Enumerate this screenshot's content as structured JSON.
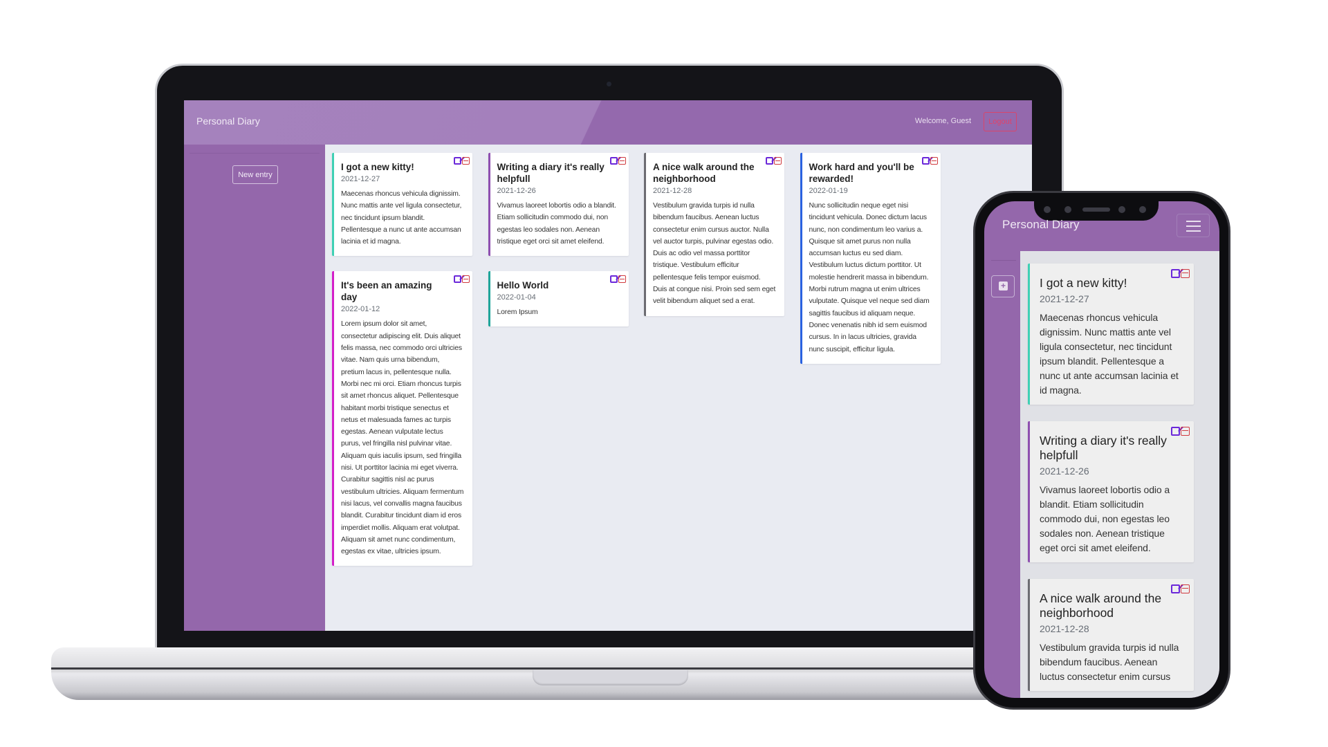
{
  "app": {
    "title": "Personal Diary",
    "welcome": "Welcome, Guest",
    "logout_label": "Logout",
    "new_entry_label": "New entry"
  },
  "colors": {
    "brand": "#9467ab",
    "logout": "#e0436a",
    "edit": "#6b28d9",
    "delete": "#d0393e"
  },
  "entries": [
    {
      "title": "I got a new kitty!",
      "date": "2021-12-27",
      "body": "Maecenas rhoncus vehicula dignissim. Nunc mattis ante vel ligula consectetur, nec tincidunt ipsum blandit. Pellentesque a nunc ut ante accumsan lacinia et id magna.",
      "color": "#3fd0b4"
    },
    {
      "title": "Writing a diary it's really helpfull",
      "date": "2021-12-26",
      "body": "Vivamus laoreet lobortis odio a blandit. Etiam sollicitudin commodo dui, non egestas leo sodales non. Aenean tristique eget orci sit amet eleifend.",
      "color": "#8e4fb0"
    },
    {
      "title": "A nice walk around the neighborhood",
      "date": "2021-12-28",
      "body": "Vestibulum gravida turpis id nulla bibendum faucibus. Aenean luctus consectetur enim cursus auctor. Nulla vel auctor turpis, pulvinar egestas odio. Duis ac odio vel massa porttitor tristique. Vestibulum efficitur pellentesque felis tempor euismod. Duis at congue nisi. Proin sed sem eget velit bibendum aliquet sed a erat.",
      "color": "#6c6c72"
    },
    {
      "title": "Work hard and you'll be rewarded!",
      "date": "2022-01-19",
      "body": "Nunc sollicitudin neque eget nisi tincidunt vehicula. Donec dictum lacus nunc, non condimentum leo varius a. Quisque sit amet purus non nulla accumsan luctus eu sed diam. Vestibulum luctus dictum porttitor. Ut molestie hendrerit massa in bibendum. Morbi rutrum magna ut enim ultrices vulputate. Quisque vel neque sed diam sagittis faucibus id aliquam neque. Donec venenatis nibh id sem euismod cursus. In in lacus ultricies, gravida nunc suscipit, efficitur ligula.",
      "color": "#2a62e0"
    },
    {
      "title": "It's been an amazing day",
      "date": "2022-01-12",
      "body": "Lorem ipsum dolor sit amet, consectetur adipiscing elit. Duis aliquet felis massa, nec commodo orci ultricies vitae. Nam quis urna bibendum, pretium lacus in, pellentesque nulla. Morbi nec mi orci. Etiam rhoncus turpis sit amet rhoncus aliquet. Pellentesque habitant morbi tristique senectus et netus et malesuada fames ac turpis egestas. Aenean vulputate lectus purus, vel fringilla nisl pulvinar vitae. Aliquam quis iaculis ipsum, sed fringilla nisi. Ut porttitor lacinia mi eget viverra. Curabitur sagittis nisl ac purus vestibulum ultricies. Aliquam fermentum nisi lacus, vel convallis magna faucibus blandit. Curabitur tincidunt diam id eros imperdiet mollis. Aliquam erat volutpat. Aliquam sit amet nunc condimentum, egestas ex vitae, ultricies ipsum.",
      "color": "#d41fc9"
    },
    {
      "title": "Hello World",
      "date": "2022-01-04",
      "body": "Lorem Ipsum",
      "color": "#1fa59a"
    }
  ],
  "desktop_columns": [
    [
      0,
      4
    ],
    [
      1,
      5
    ],
    [
      2
    ],
    [
      3
    ]
  ],
  "mobile_entries": [
    0,
    1,
    2
  ]
}
